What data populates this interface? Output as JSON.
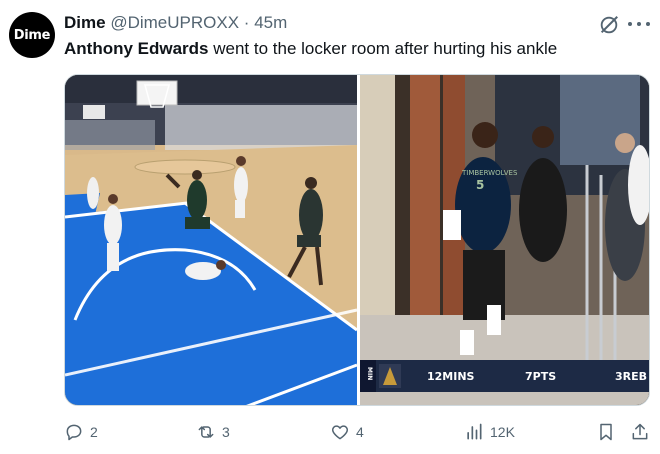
{
  "tweet": {
    "avatar_text": "Dime",
    "display_name": "Dime",
    "handle": "@DimeUPROXX",
    "separator": "·",
    "time": "45m",
    "text_name": "Anthony Edwards",
    "text_rest": " went to the locker room after hurting his ankle"
  },
  "media": {
    "jersey_text": "TIMBERWOLVES",
    "jersey_number": "5",
    "scoreboard": {
      "min_label": "MIN",
      "stats": [
        "12MINS",
        "7PTS",
        "3REB"
      ]
    }
  },
  "actions": {
    "replies": "2",
    "reposts": "3",
    "likes": "4",
    "views": "12K"
  },
  "icons": [
    "grok-icon",
    "more-icon",
    "reply-icon",
    "repost-icon",
    "like-icon",
    "views-icon",
    "bookmark-icon",
    "share-icon"
  ],
  "colors": {
    "text": "#0f1419",
    "muted": "#536471",
    "court_blue": "#1e6fd9",
    "timberwolves_navy": "#0c2340"
  }
}
